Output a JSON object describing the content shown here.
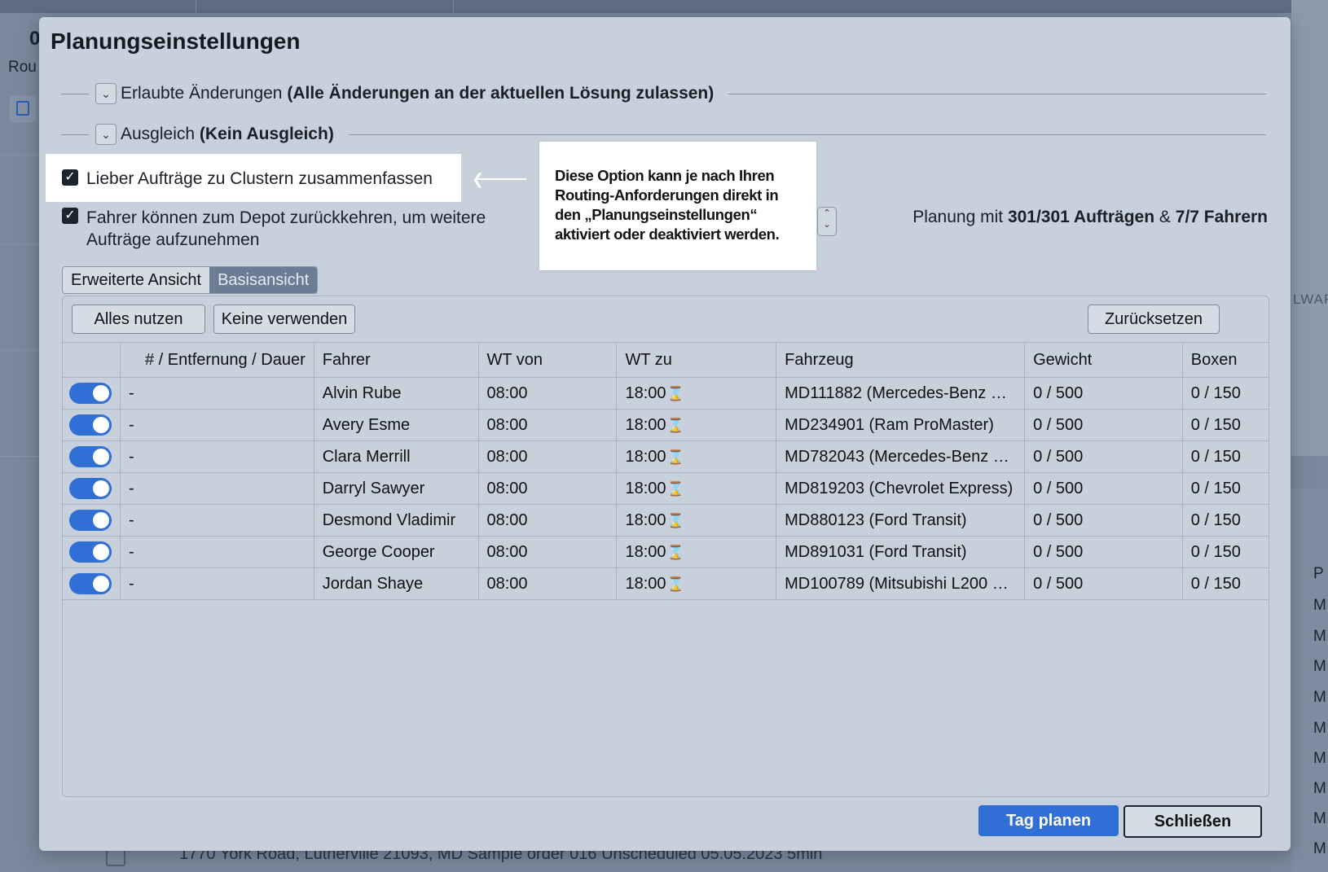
{
  "background": {
    "left_value": "0",
    "left_label": "Rou",
    "right_label": "LWAR",
    "right_rows": [
      "P",
      "M",
      "M",
      "M",
      "M",
      "M",
      "M",
      "M",
      "M",
      "M"
    ],
    "bottom_row": "1770 York Road, Lutherville 21093, MD          Sample order 016          Unscheduled    05.05.2023    5min"
  },
  "dialog": {
    "title": "Planungseinstellungen",
    "sections": [
      {
        "label": "Erlaubte Änderungen",
        "value": "(Alle Änderungen an der aktuellen Lösung zulassen)"
      },
      {
        "label": "Ausgleich",
        "value": "(Kein Ausgleich)"
      }
    ],
    "options": [
      {
        "label": "Lieber Aufträge zu Clustern zusammenfassen",
        "checked": true
      },
      {
        "label": "Fahrer können zum Depot zurückkehren, um weitere Aufträge aufzunehmen",
        "checked": true
      }
    ],
    "callout": "Diese Option kann je nach Ihren Routing-Anforderungen direkt in den „Planungseinstellungen“ aktiviert oder deaktiviert werden.",
    "summary": {
      "prefix": "Planung mit",
      "orders": "301/301 Aufträgen",
      "amp": "&",
      "drivers": "7/7 Fahrern"
    },
    "view_tabs": [
      "Erweiterte Ansicht",
      "Basisansicht"
    ],
    "active_view_tab": "Basisansicht",
    "toolbar": {
      "use_all": "Alles nutzen",
      "use_none": "Keine verwenden",
      "reset": "Zurücksetzen"
    },
    "table": {
      "columns": [
        "# / Entfernung / Dauer",
        "Fahrer",
        "WT von",
        "WT zu",
        "Fahrzeug",
        "Gewicht",
        "Boxen"
      ],
      "rows": [
        {
          "enabled": true,
          "stats": "-",
          "driver": "Alvin Rube",
          "from": "08:00",
          "to": "18:00",
          "vehicle": "MD111882 (Mercedes-Benz …",
          "weight": "0 / 500",
          "boxes": "0 / 150"
        },
        {
          "enabled": true,
          "stats": "-",
          "driver": "Avery Esme",
          "from": "08:00",
          "to": "18:00",
          "vehicle": "MD234901 (Ram ProMaster)",
          "weight": "0 / 500",
          "boxes": "0 / 150"
        },
        {
          "enabled": true,
          "stats": "-",
          "driver": "Clara Merrill",
          "from": "08:00",
          "to": "18:00",
          "vehicle": "MD782043 (Mercedes-Benz …",
          "weight": "0 / 500",
          "boxes": "0 / 150"
        },
        {
          "enabled": true,
          "stats": "-",
          "driver": "Darryl Sawyer",
          "from": "08:00",
          "to": "18:00",
          "vehicle": "MD819203 (Chevrolet Express)",
          "weight": "0 / 500",
          "boxes": "0 / 150"
        },
        {
          "enabled": true,
          "stats": "-",
          "driver": "Desmond Vladimir",
          "from": "08:00",
          "to": "18:00",
          "vehicle": "MD880123 (Ford Transit)",
          "weight": "0 / 500",
          "boxes": "0 / 150"
        },
        {
          "enabled": true,
          "stats": "-",
          "driver": "George Cooper",
          "from": "08:00",
          "to": "18:00",
          "vehicle": "MD891031 (Ford Transit)",
          "weight": "0 / 500",
          "boxes": "0 / 150"
        },
        {
          "enabled": true,
          "stats": "-",
          "driver": "Jordan Shaye",
          "from": "08:00",
          "to": "18:00",
          "vehicle": "MD100789 (Mitsubishi L200 …",
          "weight": "0 / 500",
          "boxes": "0 / 150"
        }
      ]
    },
    "footer": {
      "primary": "Tag planen",
      "secondary": "Schließen"
    }
  },
  "icons": {
    "chevron": "chevron-down-icon",
    "checkmark": "checkmark-icon",
    "hourglass": "hourglass-icon",
    "arrow": "arrow-left-icon"
  },
  "colors": {
    "accent": "#2f6fd6",
    "dialog_bg": "#c8d0dc",
    "active_tab": "#6c7c94"
  }
}
